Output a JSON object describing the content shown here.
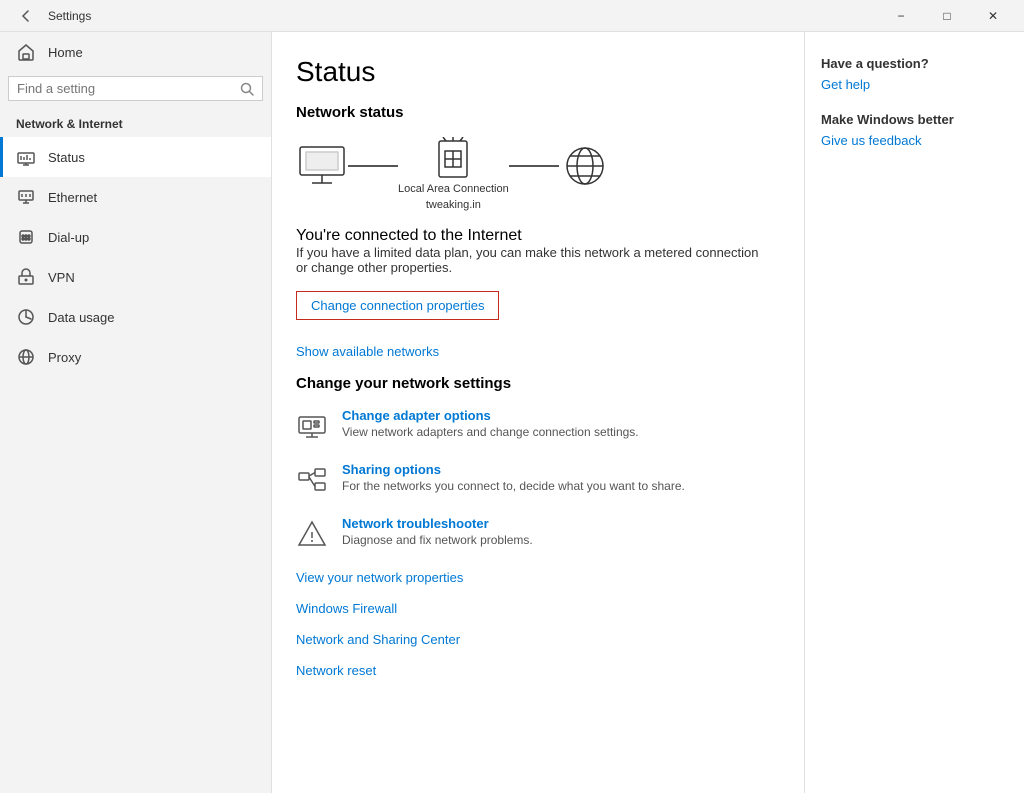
{
  "titlebar": {
    "title": "Settings",
    "minimize": "−",
    "maximize": "□",
    "close": "✕"
  },
  "sidebar": {
    "search_placeholder": "Find a setting",
    "section_label": "Network & Internet",
    "nav_items": [
      {
        "id": "home",
        "label": "Home",
        "icon": "home"
      },
      {
        "id": "status",
        "label": "Status",
        "icon": "status",
        "active": true
      },
      {
        "id": "ethernet",
        "label": "Ethernet",
        "icon": "ethernet"
      },
      {
        "id": "dialup",
        "label": "Dial-up",
        "icon": "dialup"
      },
      {
        "id": "vpn",
        "label": "VPN",
        "icon": "vpn"
      },
      {
        "id": "data-usage",
        "label": "Data usage",
        "icon": "data"
      },
      {
        "id": "proxy",
        "label": "Proxy",
        "icon": "proxy"
      }
    ]
  },
  "content": {
    "page_title": "Status",
    "network_status_title": "Network status",
    "connection_name": "Local Area Connection",
    "connection_domain": "tweaking.in",
    "connected_title": "You're connected to the Internet",
    "connected_desc": "If you have a limited data plan, you can make this network a metered connection or change other properties.",
    "change_btn": "Change connection properties",
    "show_networks": "Show available networks",
    "change_settings_title": "Change your network settings",
    "settings": [
      {
        "id": "adapter",
        "title": "Change adapter options",
        "desc": "View network adapters and change connection settings.",
        "icon": "adapter"
      },
      {
        "id": "sharing",
        "title": "Sharing options",
        "desc": "For the networks you connect to, decide what you want to share.",
        "icon": "sharing"
      },
      {
        "id": "troubleshooter",
        "title": "Network troubleshooter",
        "desc": "Diagnose and fix network problems.",
        "icon": "troubleshooter"
      }
    ],
    "links": [
      "View your network properties",
      "Windows Firewall",
      "Network and Sharing Center",
      "Network reset"
    ]
  },
  "right_panel": {
    "help_title": "Have a question?",
    "help_link": "Get help",
    "feedback_title": "Make Windows better",
    "feedback_link": "Give us feedback"
  }
}
